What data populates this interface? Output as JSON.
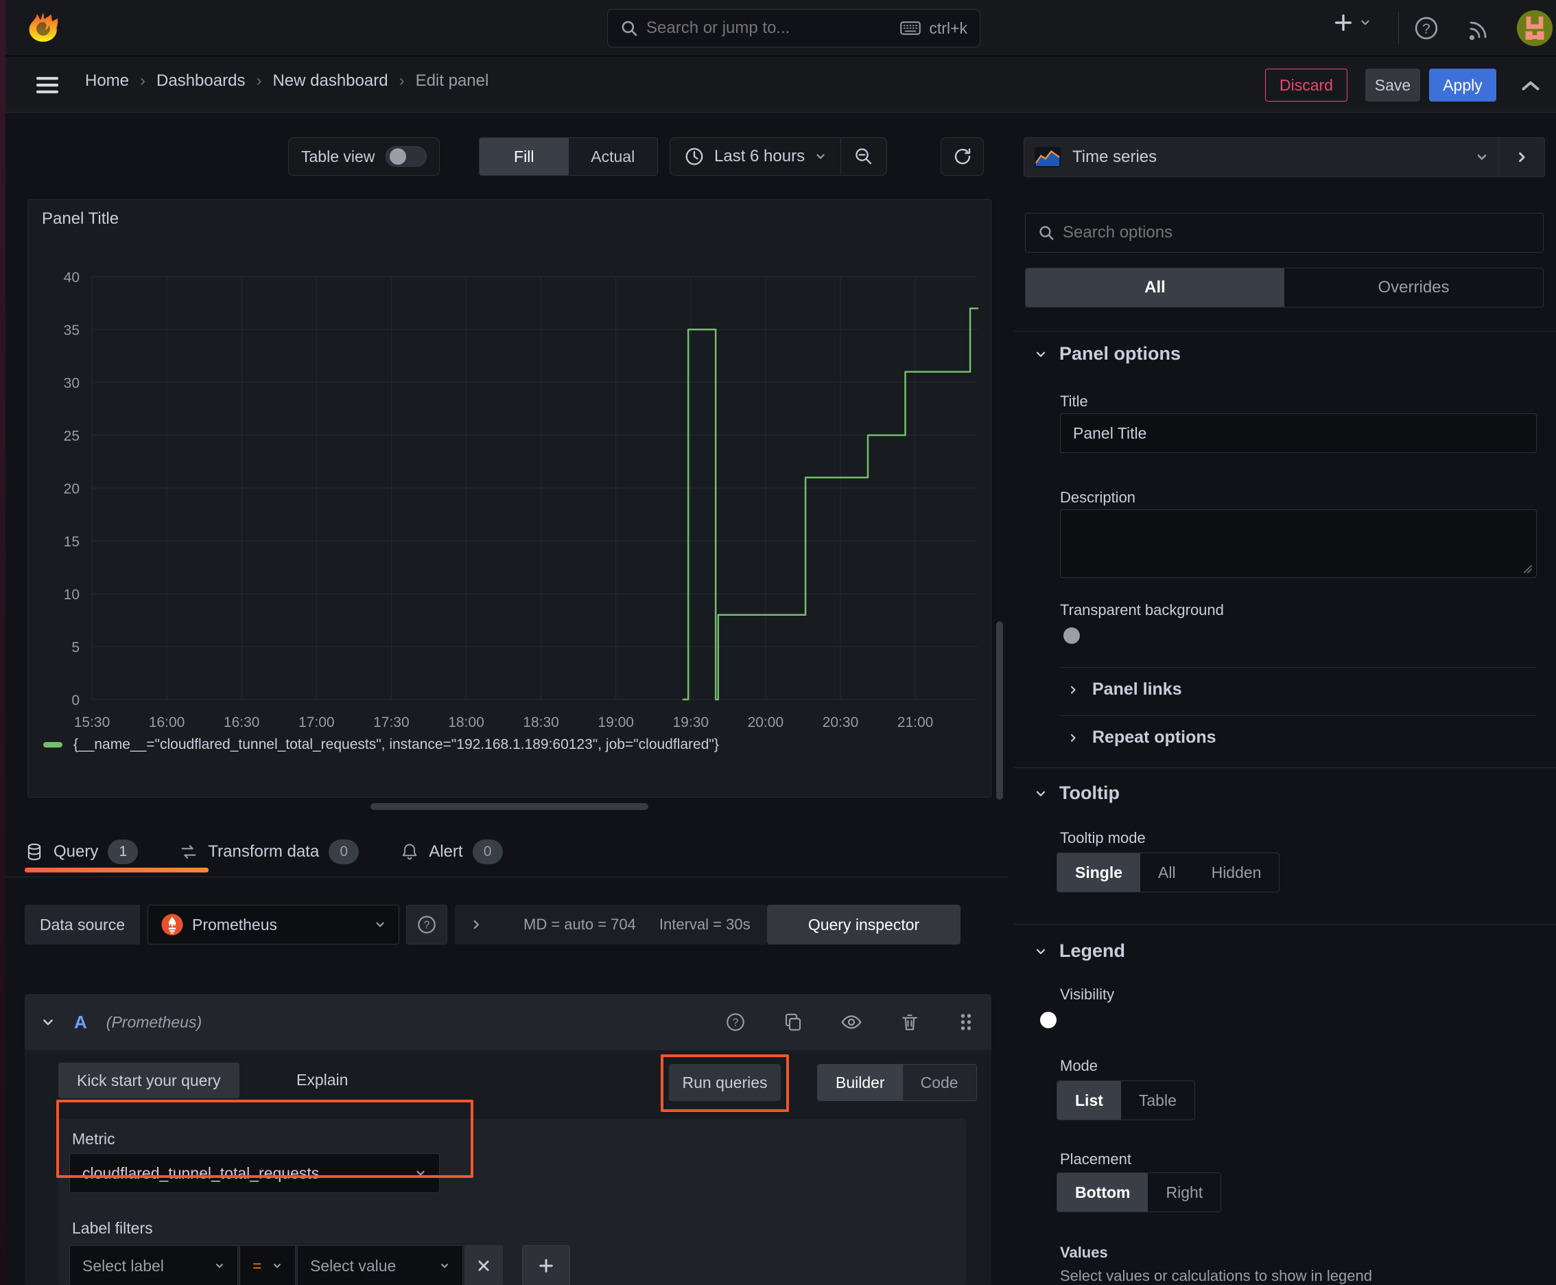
{
  "topbar": {
    "search_placeholder": "Search or jump to...",
    "shortcut": "ctrl+k"
  },
  "breadcrumb": {
    "items": [
      "Home",
      "Dashboards",
      "New dashboard",
      "Edit panel"
    ],
    "separator": "›"
  },
  "actions": {
    "discard": "Discard",
    "save": "Save",
    "apply": "Apply"
  },
  "toolbar": {
    "table_view_label": "Table view",
    "fill_label": "Fill",
    "actual_label": "Actual",
    "time_range": "Last 6 hours"
  },
  "viz_picker": {
    "name": "Time series"
  },
  "options_pane": {
    "search_placeholder": "Search options",
    "tabs": {
      "all": "All",
      "overrides": "Overrides"
    },
    "panel_options": {
      "header": "Panel options",
      "title_label": "Title",
      "title_value": "Panel Title",
      "description_label": "Description",
      "transparent_label": "Transparent background"
    },
    "panel_links": "Panel links",
    "repeat_options": "Repeat options",
    "tooltip": {
      "header": "Tooltip",
      "mode_label": "Tooltip mode",
      "options": [
        "Single",
        "All",
        "Hidden"
      ],
      "selected": "Single"
    },
    "legend": {
      "header": "Legend",
      "visibility_label": "Visibility",
      "mode_label": "Mode",
      "mode_options": [
        "List",
        "Table"
      ],
      "mode_selected": "List",
      "placement_label": "Placement",
      "placement_options": [
        "Bottom",
        "Right"
      ],
      "placement_selected": "Bottom",
      "values_label": "Values",
      "values_help": "Select values or calculations to show in legend"
    }
  },
  "query_section": {
    "tabs": [
      {
        "label": "Query",
        "count": "1"
      },
      {
        "label": "Transform data",
        "count": "0"
      },
      {
        "label": "Alert",
        "count": "0"
      }
    ],
    "datasource_label": "Data source",
    "datasource_name": "Prometheus",
    "max_data_points": "MD = auto = 704",
    "interval": "Interval = 30s",
    "query_inspector": "Query inspector",
    "ref_id": "A",
    "ref_hint": "(Prometheus)",
    "kick_start": "Kick start your query",
    "explain_label": "Explain",
    "run_queries": "Run queries",
    "builder": "Builder",
    "code": "Code",
    "metric_label": "Metric",
    "metric_value": "cloudflared_tunnel_total_requests",
    "label_filters_label": "Label filters",
    "select_label_placeholder": "Select label",
    "operator": "=",
    "select_value_placeholder": "Select value"
  },
  "panel": {
    "title": "Panel Title"
  },
  "chart_data": {
    "type": "line",
    "step": true,
    "title": "Panel Title",
    "x_range": [
      "15:30",
      "21:25"
    ],
    "ylim": [
      0,
      40
    ],
    "x_ticks": [
      "15:30",
      "16:00",
      "16:30",
      "17:00",
      "17:30",
      "18:00",
      "18:30",
      "19:00",
      "19:30",
      "20:00",
      "20:30",
      "21:00"
    ],
    "y_ticks": [
      0,
      5,
      10,
      15,
      20,
      25,
      30,
      35,
      40
    ],
    "grid": true,
    "legend_position": "bottom",
    "series": [
      {
        "name": "{__name__=\"cloudflared_tunnel_total_requests\", instance=\"192.168.1.189:60123\", job=\"cloudflared\"}",
        "color": "#73BF69",
        "points": [
          [
            "19:27",
            0
          ],
          [
            "19:29",
            35
          ],
          [
            "19:40",
            0
          ],
          [
            "19:41",
            8
          ],
          [
            "20:16",
            21
          ],
          [
            "20:41",
            25
          ],
          [
            "20:56",
            31
          ],
          [
            "21:22",
            37
          ],
          [
            "21:25",
            37
          ]
        ]
      }
    ]
  },
  "colors": {
    "accent_blue": "#3D71D9",
    "destructive": "#E9486F",
    "annotation_orange": "#F4562A",
    "series_green": "#73BF69",
    "tab_underline_from": "#F55F3E",
    "tab_underline_to": "#FF8833",
    "operator_orange": "#FF780A"
  }
}
